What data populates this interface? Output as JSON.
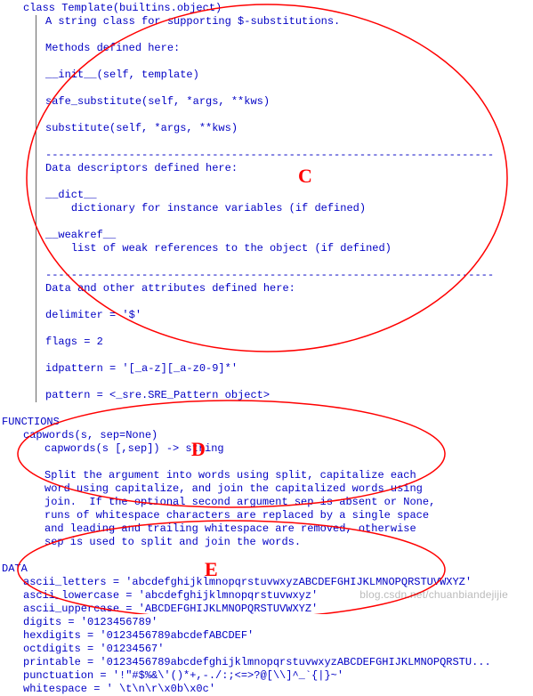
{
  "template_class": {
    "header": "class Template(builtins.object)",
    "desc": "A string class for supporting $-substitutions.",
    "methods_label": "Methods defined here:",
    "methods": [
      "__init__(self, template)",
      "safe_substitute(self, *args, **kws)",
      "substitute(self, *args, **kws)"
    ],
    "sep": "----------------------------------------------------------------------",
    "data_desc_label": "Data descriptors defined here:",
    "dict_name": "__dict__",
    "dict_expl": "dictionary for instance variables (if defined)",
    "weakref_name": "__weakref__",
    "weakref_expl": "list of weak references to the object (if defined)",
    "other_attr_label": "Data and other attributes defined here:",
    "attrs": [
      "delimiter = '$'",
      "flags = 2",
      "idpattern = '[_a-z][_a-z0-9]*'",
      "pattern = <_sre.SRE_Pattern object>"
    ]
  },
  "functions": {
    "header": "FUNCTIONS",
    "capwords_sig": "capwords(s, sep=None)",
    "capwords_sig2": "capwords(s [,sep]) -> string",
    "capwords_doc": [
      "Split the argument into words using split, capitalize each",
      "word using capitalize, and join the capitalized words using",
      "join.  If the optional second argument sep is absent or None,",
      "runs of whitespace characters are replaced by a single space",
      "and leading and trailing whitespace are removed, otherwise",
      "sep is used to split and join the words."
    ]
  },
  "data_section": {
    "header": "DATA",
    "lines": [
      "ascii_letters = 'abcdefghijklmnopqrstuvwxyzABCDEFGHIJKLMNOPQRSTUVWXYZ'",
      "ascii_lowercase = 'abcdefghijklmnopqrstuvwxyz'",
      "ascii_uppercase = 'ABCDEFGHIJKLMNOPQRSTUVWXYZ'",
      "digits = '0123456789'",
      "hexdigits = '0123456789abcdefABCDEF'",
      "octdigits = '01234567'",
      "printable = '0123456789abcdefghijklmnopqrstuvwxyzABCDEFGHIJKLMNOPQRSTU...",
      "punctuation = '!\"#$%&\\'()*+,-./:;<=>?@[\\\\]^_`{|}~'",
      "whitespace = ' \\t\\n\\r\\x0b\\x0c'"
    ]
  },
  "annotations": {
    "C": "C",
    "D": "D",
    "E": "E"
  },
  "watermark": "blog.csdn.net/chuanbiandejijie"
}
